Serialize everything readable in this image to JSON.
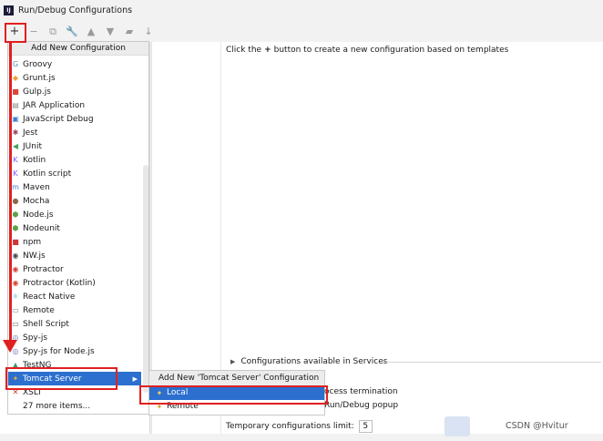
{
  "window": {
    "title": "Run/Debug Configurations",
    "logo": "IJ"
  },
  "toolbar": {
    "buttons": [
      {
        "name": "add-icon",
        "glyph": "+"
      },
      {
        "name": "remove-icon",
        "glyph": "−"
      },
      {
        "name": "copy-icon",
        "glyph": "⧉"
      },
      {
        "name": "wrench-icon",
        "glyph": "🔧"
      },
      {
        "name": "arrow-up-icon",
        "glyph": "▲"
      },
      {
        "name": "arrow-down-icon",
        "glyph": "▼"
      },
      {
        "name": "folder-icon",
        "glyph": "▰"
      },
      {
        "name": "sort-icon",
        "glyph": "↓"
      }
    ]
  },
  "hint": {
    "before": "Click the",
    "plus": "+",
    "after": "button to create a new configuration based on templates"
  },
  "menu": {
    "header": "Add New Configuration",
    "items": [
      {
        "label": "Groovy",
        "icon": "groovy-icon",
        "glyph": "G",
        "color": "#4298b8"
      },
      {
        "label": "Grunt.js",
        "icon": "grunt-icon",
        "glyph": "◆",
        "color": "#f0a030"
      },
      {
        "label": "Gulp.js",
        "icon": "gulp-icon",
        "glyph": "■",
        "color": "#d9463b"
      },
      {
        "label": "JAR Application",
        "icon": "jar-icon",
        "glyph": "▤",
        "color": "#8a8a8a"
      },
      {
        "label": "JavaScript Debug",
        "icon": "js-debug-icon",
        "glyph": "▣",
        "color": "#3a7fd0"
      },
      {
        "label": "Jest",
        "icon": "jest-icon",
        "glyph": "✱",
        "color": "#99425b"
      },
      {
        "label": "JUnit",
        "icon": "junit-icon",
        "glyph": "◀",
        "color": "#3fa35c"
      },
      {
        "label": "Kotlin",
        "icon": "kotlin-icon",
        "glyph": "K",
        "color": "#7f52ff"
      },
      {
        "label": "Kotlin script",
        "icon": "kotlin-script-icon",
        "glyph": "K",
        "color": "#7f52ff"
      },
      {
        "label": "Maven",
        "icon": "maven-icon",
        "glyph": "m",
        "color": "#3a7fd0"
      },
      {
        "label": "Mocha",
        "icon": "mocha-icon",
        "glyph": "●",
        "color": "#8d6748"
      },
      {
        "label": "Node.js",
        "icon": "nodejs-icon",
        "glyph": "⬢",
        "color": "#5fa04e"
      },
      {
        "label": "Nodeunit",
        "icon": "nodeunit-icon",
        "glyph": "⬢",
        "color": "#5fa04e"
      },
      {
        "label": "npm",
        "icon": "npm-icon",
        "glyph": "■",
        "color": "#cb3837"
      },
      {
        "label": "NW.js",
        "icon": "nwjs-icon",
        "glyph": "◉",
        "color": "#3c4a5c"
      },
      {
        "label": "Protractor",
        "icon": "protractor-icon",
        "glyph": "◉",
        "color": "#d94030"
      },
      {
        "label": "Protractor (Kotlin)",
        "icon": "protractor-kotlin-icon",
        "glyph": "◉",
        "color": "#d94030"
      },
      {
        "label": "React Native",
        "icon": "react-native-icon",
        "glyph": "⚛",
        "color": "#48b8d8"
      },
      {
        "label": "Remote",
        "icon": "remote-icon",
        "glyph": "▭",
        "color": "#6a8aa8"
      },
      {
        "label": "Shell Script",
        "icon": "shell-script-icon",
        "glyph": "▭",
        "color": "#6a6a6a"
      },
      {
        "label": "Spy-js",
        "icon": "spyjs-icon",
        "glyph": "◎",
        "color": "#5a7ab0"
      },
      {
        "label": "Spy-js for Node.js",
        "icon": "spyjs-node-icon",
        "glyph": "◎",
        "color": "#5a7ab0"
      },
      {
        "label": "TestNG",
        "icon": "testng-icon",
        "glyph": "▲",
        "color": "#3a9a6a"
      },
      {
        "label": "Tomcat Server",
        "icon": "tomcat-icon",
        "glyph": "✦",
        "color": "#e8b030",
        "selected": true
      },
      {
        "label": "XSLT",
        "icon": "xslt-icon",
        "glyph": "✕",
        "color": "#c84020"
      },
      {
        "label": "27 more items...",
        "icon": "",
        "glyph": "",
        "color": "#ffffff"
      }
    ]
  },
  "submenu": {
    "header": "Add New 'Tomcat Server' Configuration",
    "items": [
      {
        "label": "Local",
        "icon": "tomcat-local-icon",
        "glyph": "✦",
        "selected": true
      },
      {
        "label": "Remote",
        "icon": "tomcat-remote-icon",
        "glyph": "✦",
        "selected": false
      }
    ]
  },
  "settings": {
    "section": "Configurations available in Services",
    "option1": "ocess termination",
    "option2": "Run/Debug popup",
    "limit_label": "Temporary configurations limit:",
    "limit_value": "5"
  },
  "watermark": "CSDN @Hvitur",
  "colors": {
    "selection": "#2c6fcf",
    "annotation": "#e02020"
  }
}
